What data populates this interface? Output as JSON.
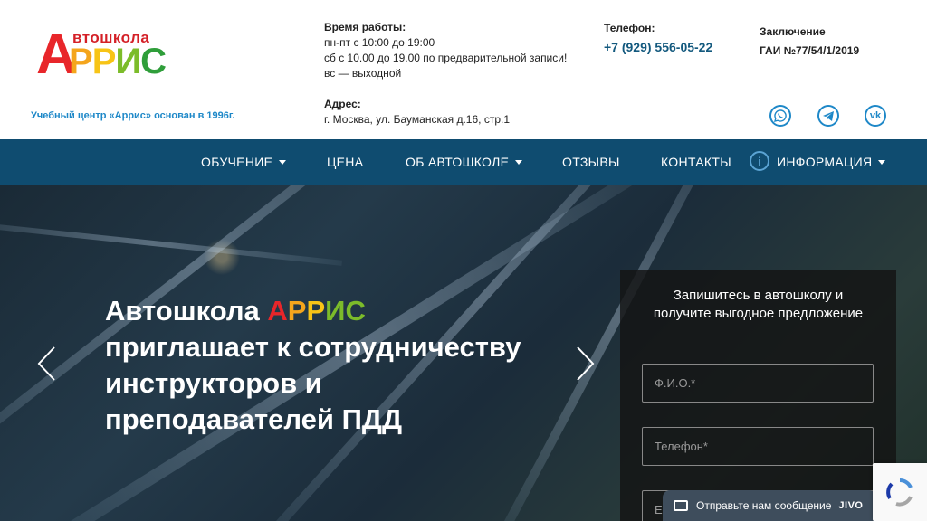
{
  "logo": {
    "top": "втошкола",
    "big_letter": "А",
    "rest": [
      "Р",
      "Р",
      "И",
      "С"
    ]
  },
  "tagline": "Учебный центр «Аррис» основан в 1996г.",
  "hours": {
    "title": "Время работы:",
    "lines": [
      "пн-пт с 10:00 до 19:00",
      "сб с 10.00 до 19.00 по предварительной записи!",
      "вс — выходной"
    ]
  },
  "address": {
    "title": "Адрес:",
    "value": "г. Москва, ул. Бауманская д.16, стр.1"
  },
  "phone": {
    "title": "Телефон:",
    "value": "+7 (929) 556-05-22"
  },
  "conclusion": {
    "title": "Заключение",
    "value": "ГАИ №77/54/1/2019"
  },
  "social": {
    "whatsapp": "whatsapp-icon",
    "telegram": "telegram-icon",
    "vk": "vk-icon",
    "vk_text": "vk"
  },
  "nav": {
    "items": [
      "ОБУЧЕНИЕ",
      "ЦЕНА",
      "ОБ АВТОШКОЛЕ",
      "ОТЗЫВЫ",
      "КОНТАКТЫ",
      "ИНФОРМАЦИЯ"
    ],
    "info_glyph": "i"
  },
  "hero": {
    "title_prefix": "Автошкола ",
    "brand": [
      "А",
      "Р",
      "Р",
      "И",
      "С"
    ],
    "title_lines": [
      "приглашает к сотрудничеству",
      "инструкторов и",
      "преподавателей ПДД"
    ]
  },
  "form": {
    "title": "Запишитесь в автошколу и получите выгодное предложение",
    "name_placeholder": "Ф.И.О.*",
    "phone_placeholder": "Телефон*",
    "email_placeholder": "E"
  },
  "jivo": {
    "label": "Отправьте нам сообщение",
    "brand": "JIVO"
  },
  "colors": {
    "nav_bg": "#0f4c70",
    "accent_blue": "#1e88c8",
    "phone_blue": "#13597e",
    "logo_red": "#e8262a"
  }
}
